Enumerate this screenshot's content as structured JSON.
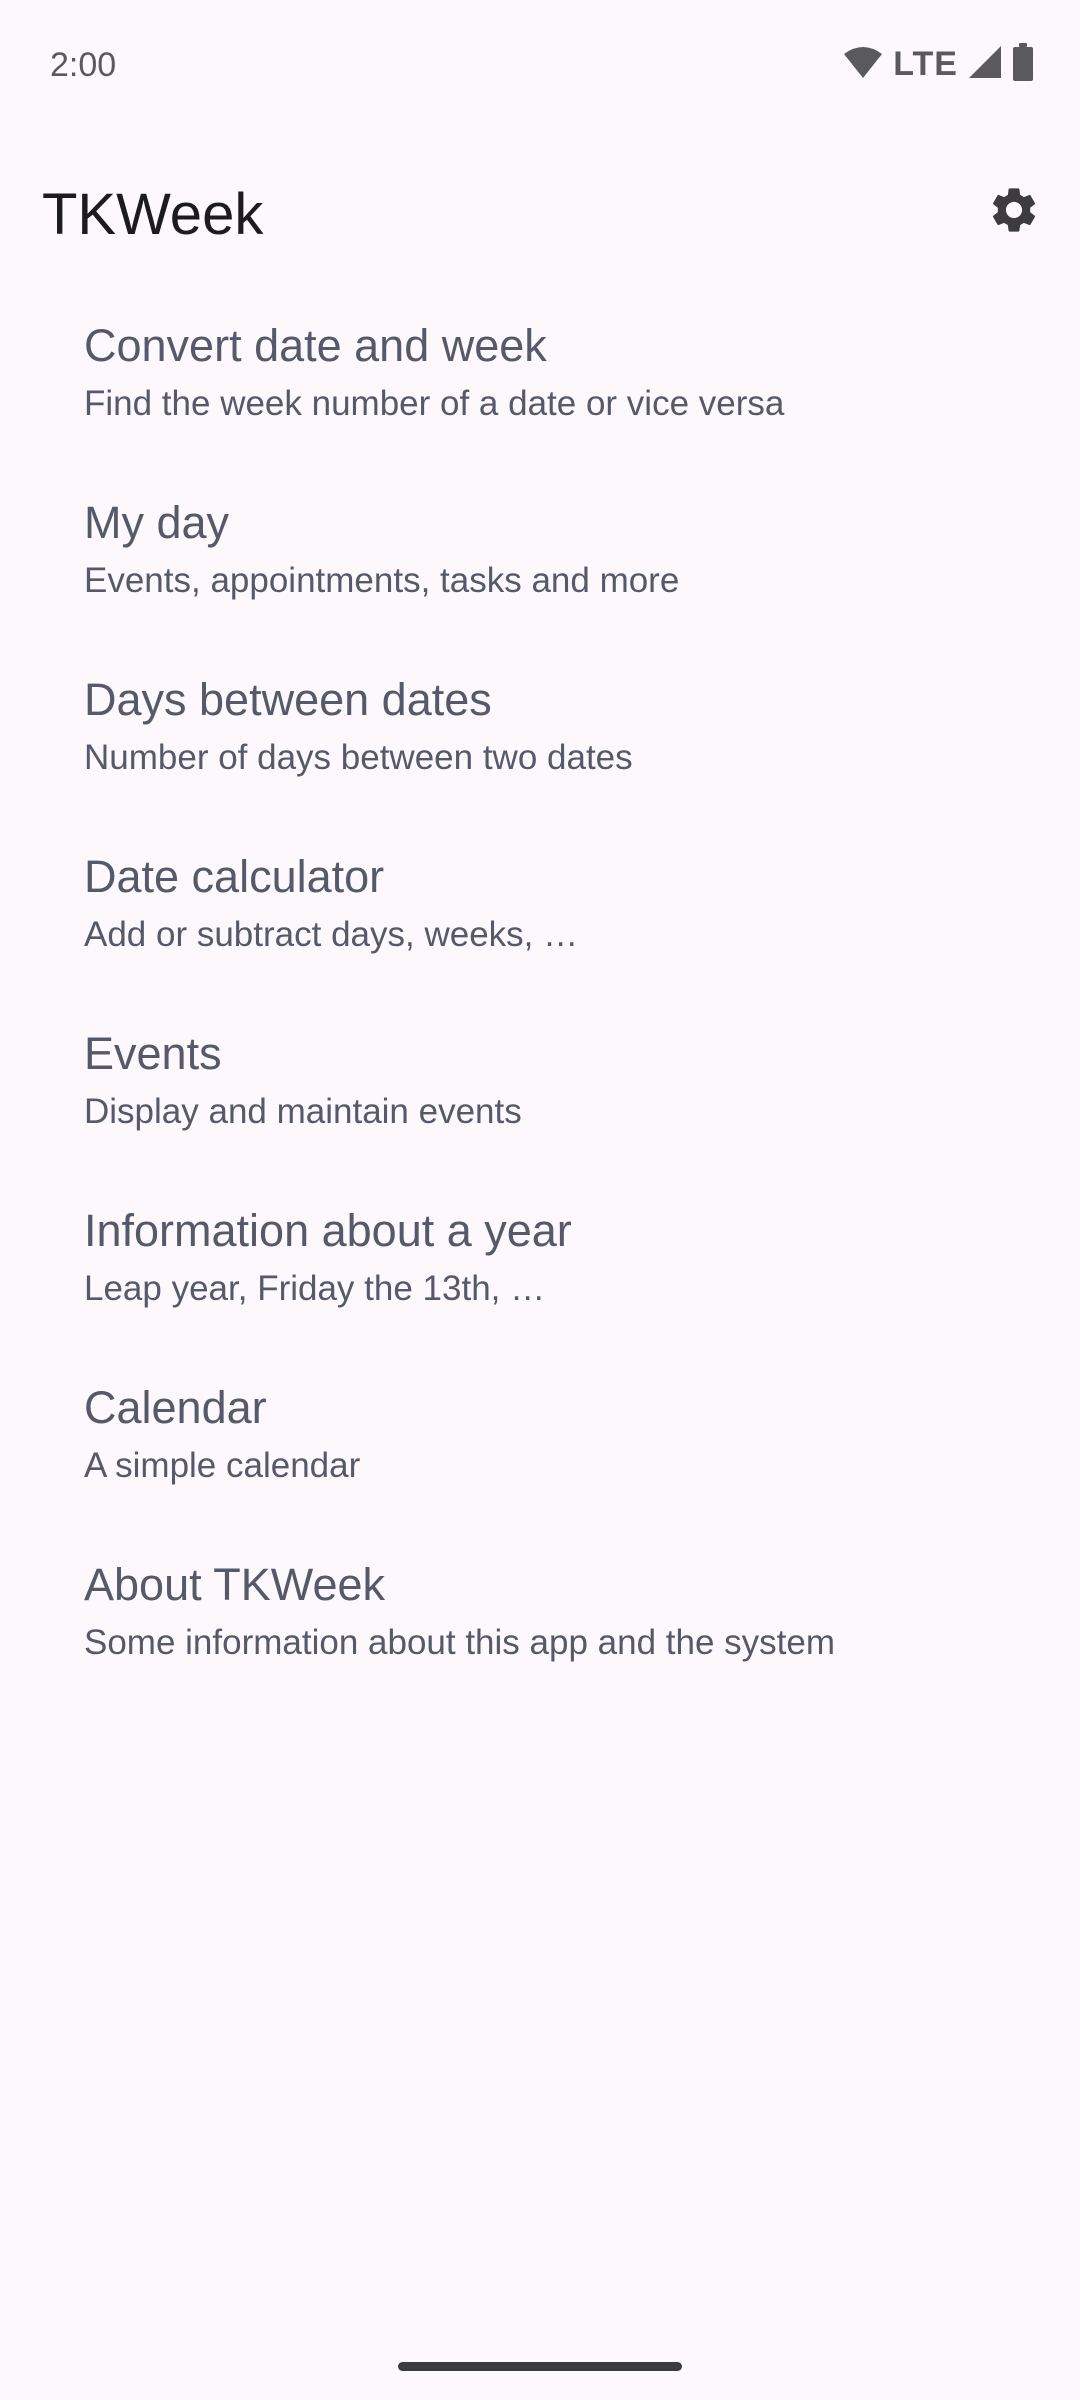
{
  "status_bar": {
    "time": "2:00",
    "network": "LTE",
    "icons": [
      "wifi-icon",
      "signal-icon",
      "battery-icon"
    ]
  },
  "app_bar": {
    "title": "TKWeek",
    "settings_icon": "gear-icon"
  },
  "menu": {
    "items": [
      {
        "title": "Convert date and week",
        "subtitle": "Find the week number of a date or vice versa"
      },
      {
        "title": "My day",
        "subtitle": "Events, appointments, tasks and more"
      },
      {
        "title": "Days between dates",
        "subtitle": "Number of days between two dates"
      },
      {
        "title": "Date calculator",
        "subtitle": "Add or subtract days, weeks, …"
      },
      {
        "title": "Events",
        "subtitle": "Display and maintain events"
      },
      {
        "title": "Information about a year",
        "subtitle": "Leap year, Friday the 13th, …"
      },
      {
        "title": "Calendar",
        "subtitle": "A simple calendar"
      },
      {
        "title": "About TKWeek",
        "subtitle": "Some information about this app and the system"
      }
    ]
  },
  "colors": {
    "background": "#fdf8fc",
    "title_text": "#1b1b20",
    "item_text": "#555a6a",
    "icon": "#3c3c40"
  }
}
